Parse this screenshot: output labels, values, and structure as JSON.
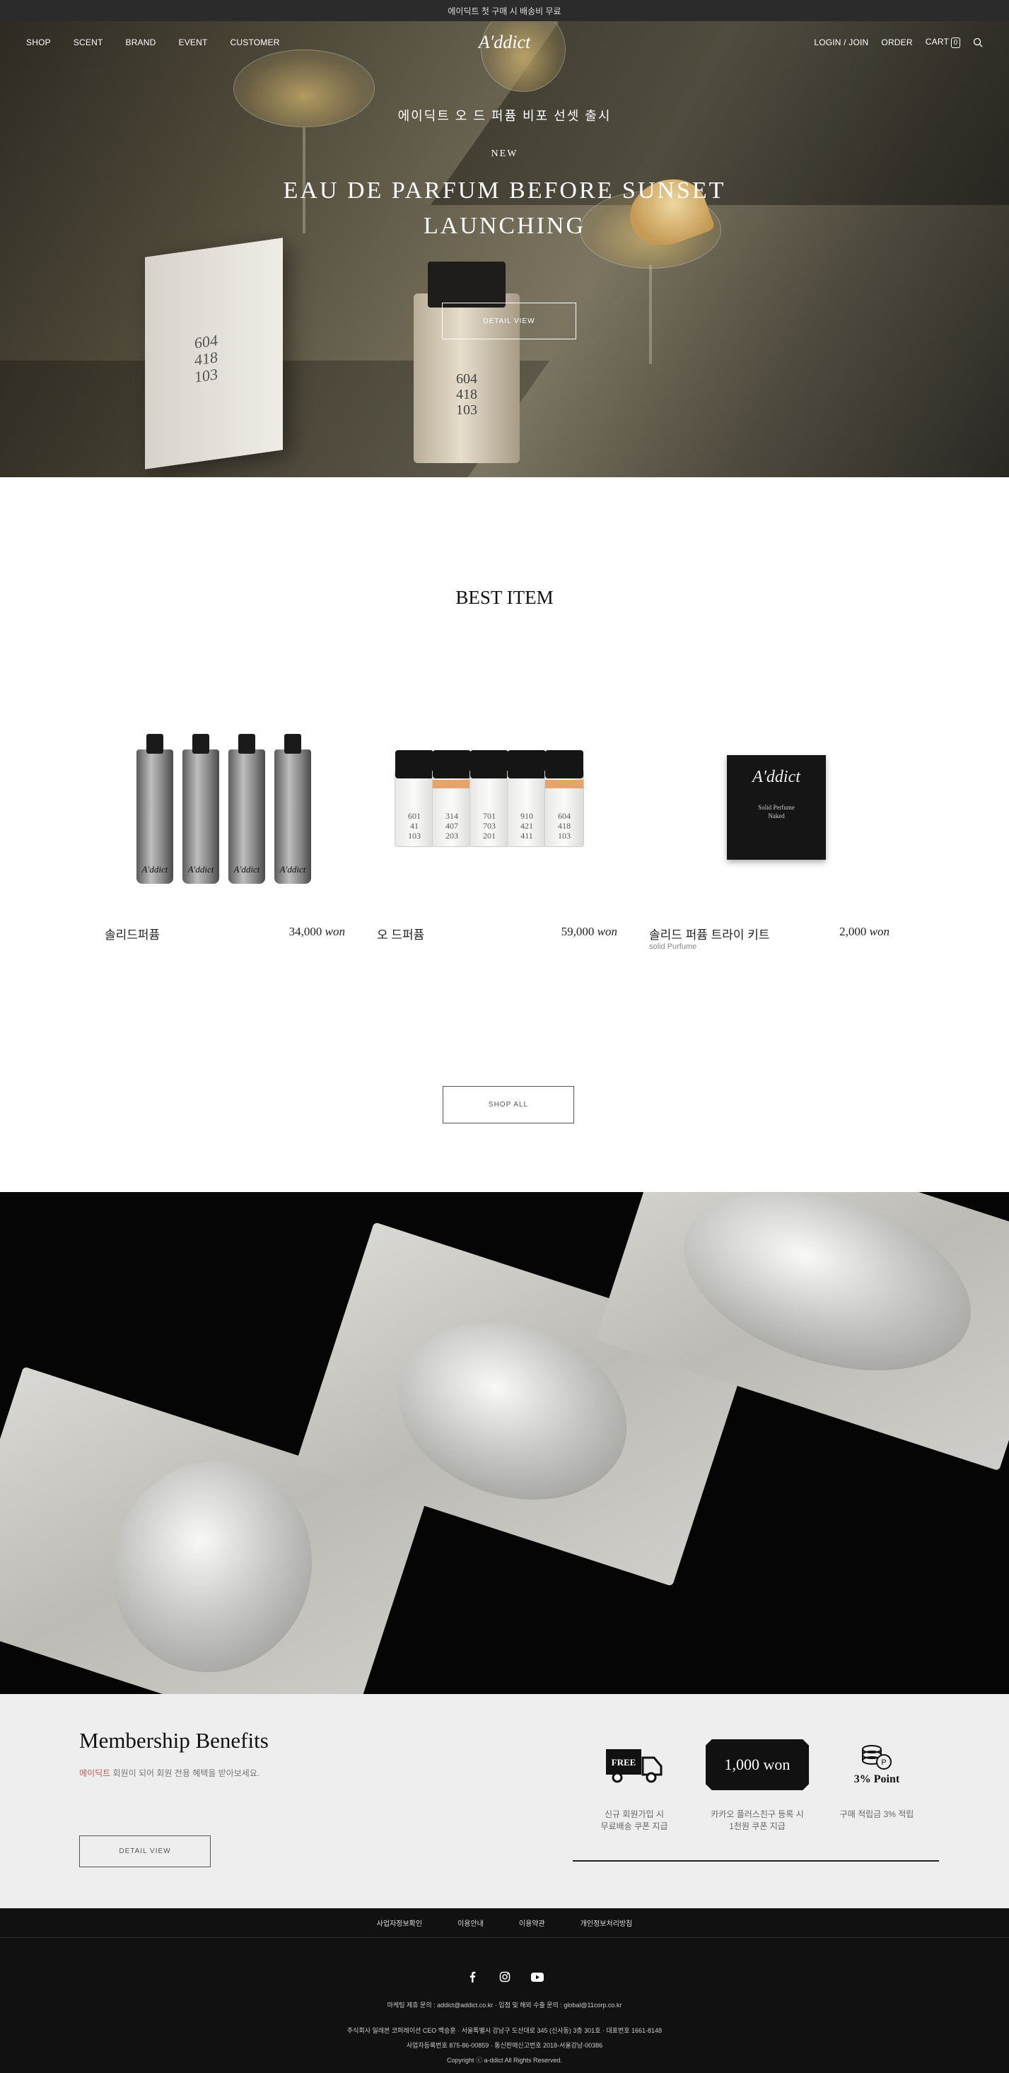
{
  "topbar": {
    "notice": "에이딕트 첫 구매 시 배송비 무료"
  },
  "nav": {
    "left": [
      "SHOP",
      "SCENT",
      "BRAND",
      "EVENT",
      "CUSTOMER"
    ],
    "logo": "A'ddict",
    "login": "LOGIN / JOIN",
    "order": "ORDER",
    "cart": "CART",
    "cart_count": "0"
  },
  "hero": {
    "subtitle_ko": "에이딕트 오 드 퍼퓸 비포 선셋 출시",
    "badge": "NEW",
    "title_line1": "EAU DE PARFUM BEFORE SUNSET",
    "title_line2": "LAUNCHING",
    "button": "DETAIL VIEW",
    "box_numbers": "604\n418\n103",
    "bottle_numbers": "604\n418\n103"
  },
  "best": {
    "title": "BEST ITEM",
    "items": [
      {
        "name": "솔리드퍼퓸",
        "price": "34,000",
        "unit": "won",
        "sub": ""
      },
      {
        "name": "오 드퍼퓸",
        "price": "59,000",
        "unit": "won",
        "sub": ""
      },
      {
        "name": "솔리드 퍼퓸 트라이 키트",
        "price": "2,000",
        "unit": "won",
        "sub": "solid Purfume"
      }
    ],
    "tube_brand": "A'ddict",
    "bottle_numbers": [
      "601\n41\n103",
      "314\n407\n203",
      "701\n703\n201",
      "910\n421\n411",
      "604\n418\n103"
    ],
    "kit_brand": "A'ddict",
    "kit_text": "Solid Perfume\nNaked",
    "shop_all": "SHOP ALL"
  },
  "membership": {
    "title": "Membership Benefits",
    "desc_highlight": "에이딕트",
    "desc_rest": " 회원이 되어 회원 전용 혜택을 받아보세요.",
    "button": "DETAIL VIEW",
    "benefits": [
      {
        "label": "FREE",
        "text_line1": "신규 회원가입 시",
        "text_line2": "무료배송 쿠폰 지급"
      },
      {
        "label": "1,000 won",
        "text_line1": "카카오 플러스친구 등록 시",
        "text_line2": "1천원 쿠폰 지급"
      },
      {
        "label": "3% Point",
        "text_line1": "구매 적립금 3% 적립",
        "text_line2": ""
      }
    ]
  },
  "footer": {
    "links": [
      "사업자정보확인",
      "이용안내",
      "이용약관",
      "개인정보처리방침"
    ],
    "contact": "마케팅 제휴 문의 : addict@addict.co.kr · 입점 및 해외 수출 문의 : global@11corp.co.kr",
    "company": "주식회사 일레븐 코퍼레이션 CEO 백승훈 · 서울특별시 강남구 도산대로 345 (신사동) 3층 301호 · 대표번호 1661-8148",
    "registration": "사업자등록번호 875-86-00859 · 통신판매신고번호 2018-서울강남-00386",
    "copyright": "Copyright ⓒ a-ddict All Rights Reserved."
  },
  "colors": {
    "topbar": "#2b2b2b",
    "footer": "#111111",
    "membership_bg": "#eeeeee",
    "accent": "#cc5555"
  }
}
